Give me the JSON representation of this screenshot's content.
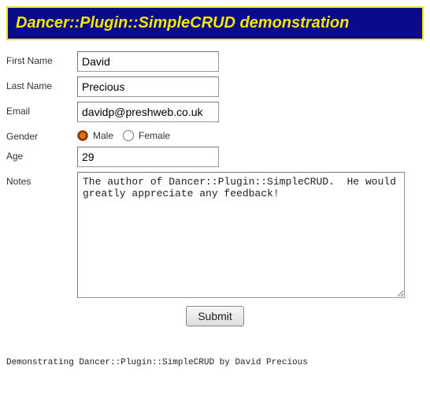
{
  "header": {
    "title": "Dancer::Plugin::SimpleCRUD demonstration"
  },
  "form": {
    "first_name": {
      "label": "First Name",
      "value": "David"
    },
    "last_name": {
      "label": "Last Name",
      "value": "Precious"
    },
    "email": {
      "label": "Email",
      "value": "davidp@preshweb.co.uk"
    },
    "gender": {
      "label": "Gender",
      "option_male": "Male",
      "option_female": "Female",
      "selected": "male"
    },
    "age": {
      "label": "Age",
      "value": "29"
    },
    "notes": {
      "label": "Notes",
      "value": "The author of Dancer::Plugin::SimpleCRUD.  He would greatly appreciate any feedback!"
    },
    "submit_label": "Submit"
  },
  "footer": {
    "text": "Demonstrating Dancer::Plugin::SimpleCRUD by David Precious"
  }
}
